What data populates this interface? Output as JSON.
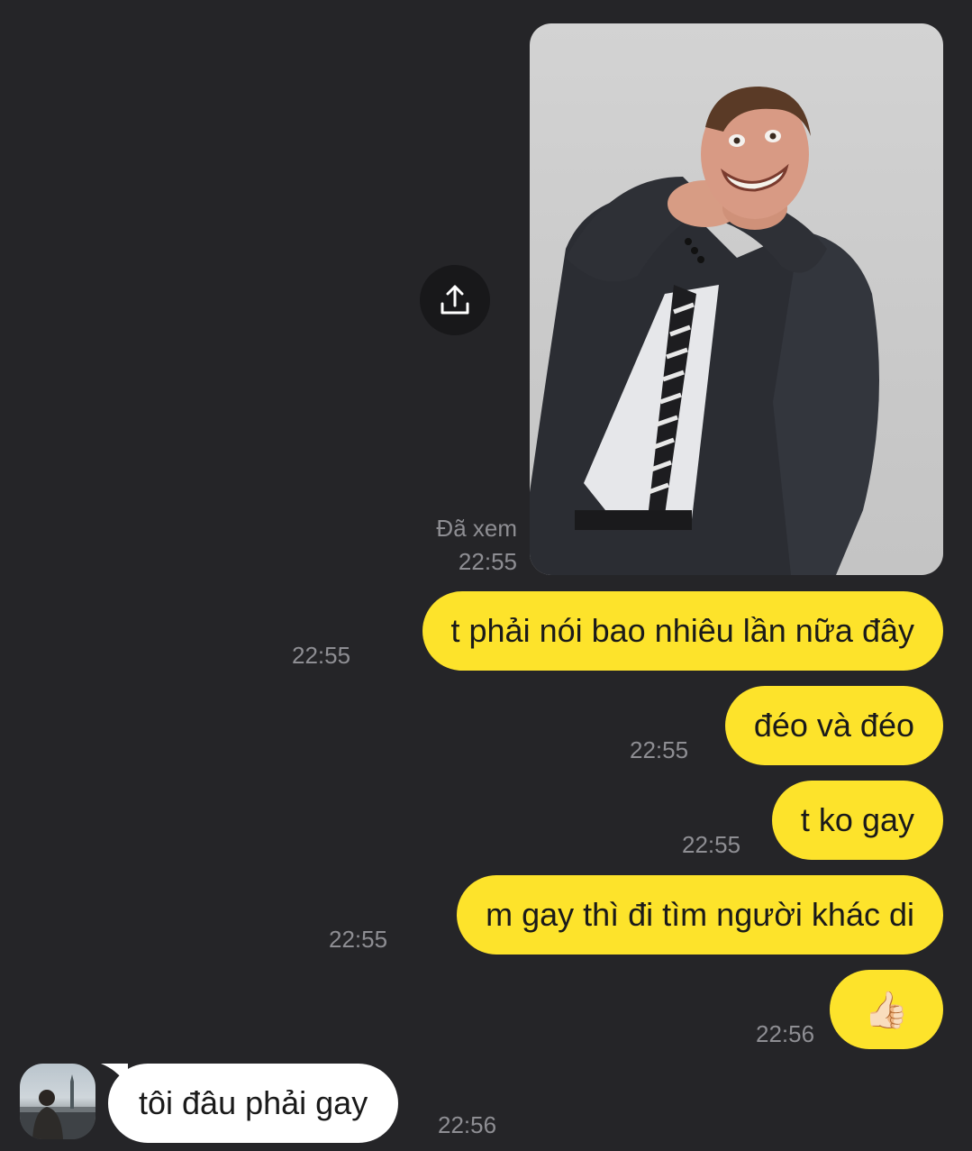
{
  "photo_message": {
    "image": "man-in-suit-choking-himself-photo",
    "share_icon": "upload-share-icon"
  },
  "read_receipt": {
    "label": "Đã xem",
    "time": "22:55"
  },
  "outgoing_messages": [
    {
      "text": "t phải nói bao nhiêu lần nữa đây",
      "time": "22:55"
    },
    {
      "text": "đéo và đéo",
      "time": "22:55"
    },
    {
      "text": "t ko gay",
      "time": "22:55"
    },
    {
      "text": "m gay thì đi tìm người khác di",
      "time": "22:55"
    },
    {
      "text": "👍🏻",
      "time": "22:56"
    }
  ],
  "incoming_message": {
    "avatar": "user-avatar",
    "text": "tôi đâu phải gay",
    "time": "22:56"
  },
  "colors": {
    "background": "#252528",
    "outgoing_bubble": "#fde32b",
    "incoming_bubble": "#ffffff",
    "timestamp": "#8e8e93"
  }
}
